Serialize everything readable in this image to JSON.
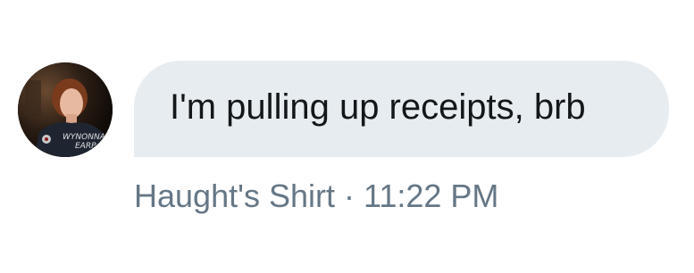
{
  "message": {
    "text": "I'm pulling up receipts, brb",
    "sender": "Haught's Shirt",
    "separator": "·",
    "time": "11:22 PM"
  },
  "avatar": {
    "icon": "profile-photo",
    "watermark_text": "WYNONNA EARP"
  },
  "colors": {
    "bubble_bg": "#e6ecf0",
    "message_text": "#14171a",
    "meta_text": "#657786"
  }
}
